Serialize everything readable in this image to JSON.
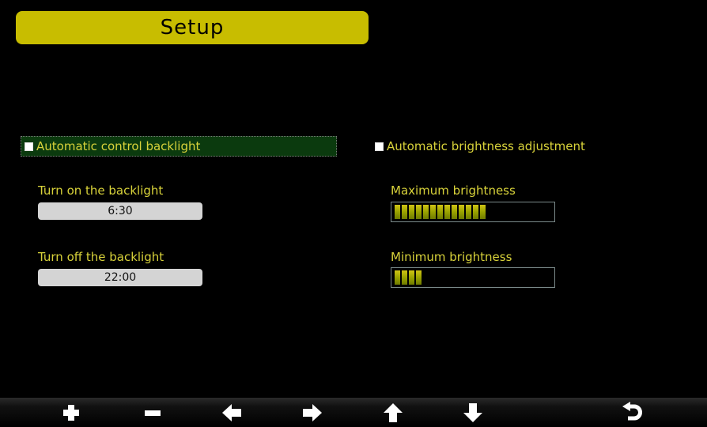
{
  "header": {
    "title": "Setup"
  },
  "backlight": {
    "auto_label": "Automatic control backlight",
    "auto_checked": false,
    "on_label": "Turn on the backlight",
    "on_value": "6:30",
    "off_label": "Turn off the backlight",
    "off_value": "22:00"
  },
  "brightness": {
    "auto_label": "Automatic brightness adjustment",
    "auto_checked": false,
    "max_label": "Maximum brightness",
    "max_level": 0.6,
    "min_label": "Minimum brightness",
    "min_level": 0.2
  },
  "toolbar": {
    "buttons": [
      "plus-icon",
      "minus-icon",
      "arrow-left-icon",
      "arrow-right-icon",
      "arrow-up-icon",
      "arrow-down-icon",
      "return-icon"
    ]
  },
  "colors": {
    "title_bg": "#c8bd00",
    "label_text": "#d8d23a",
    "selected_row_bg": "#0b3a0e",
    "bar_fill": "#9aa300"
  }
}
